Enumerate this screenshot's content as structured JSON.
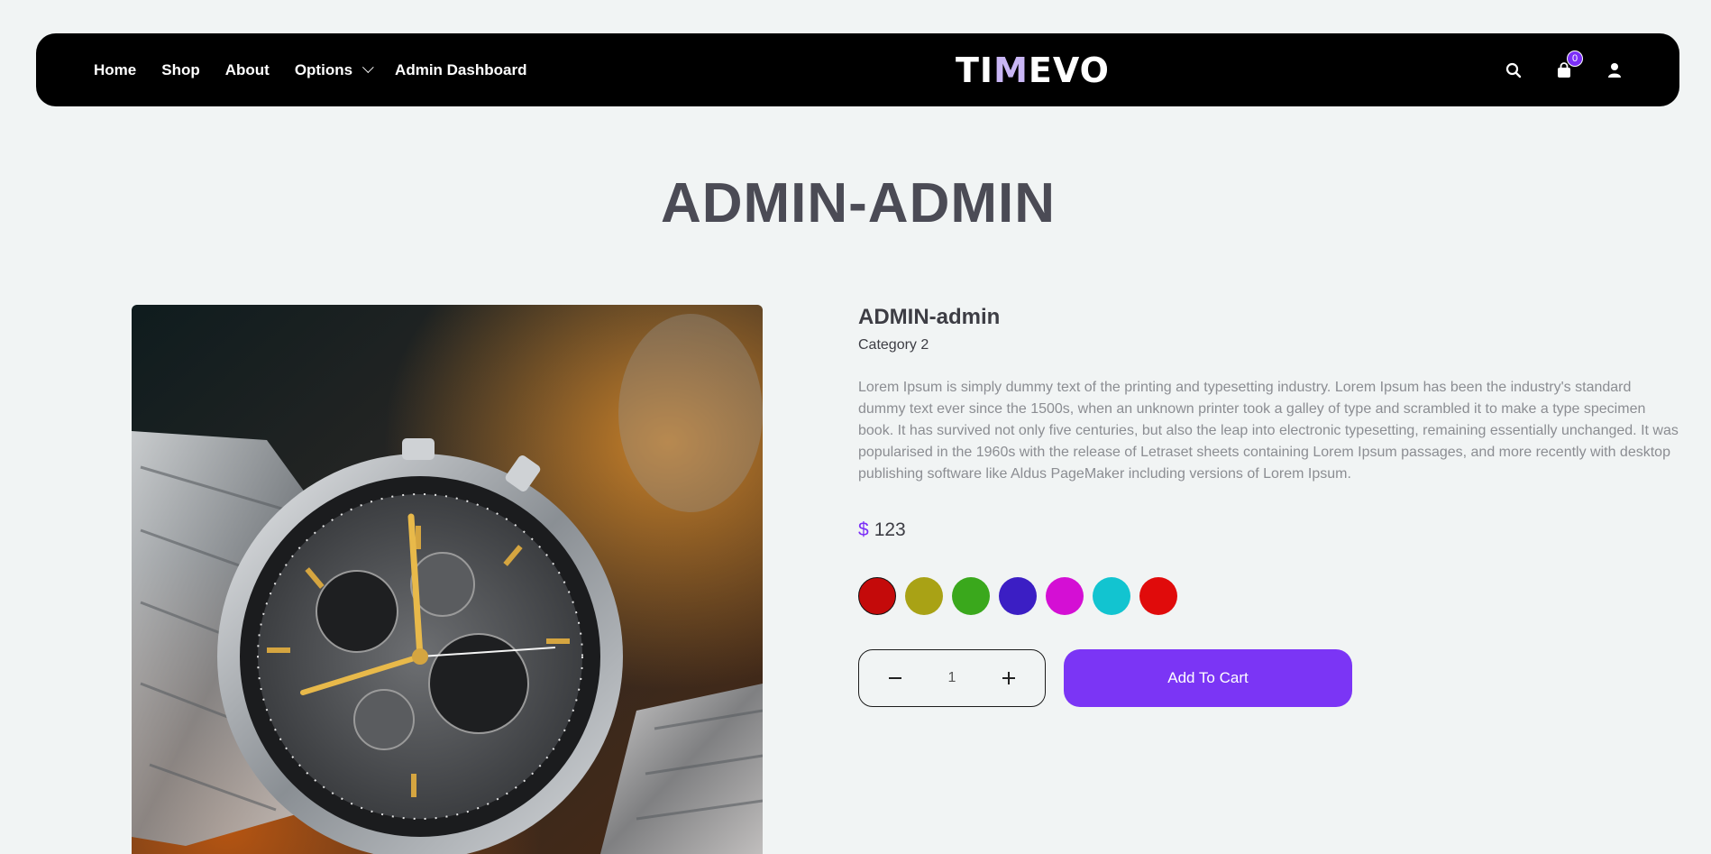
{
  "nav": {
    "links": [
      "Home",
      "Shop",
      "About",
      "Options",
      "Admin Dashboard"
    ],
    "logo_left": "TI",
    "logo_accent": "M",
    "logo_right": "EVO",
    "cart_count": "0"
  },
  "page": {
    "title": "ADMIN-ADMIN"
  },
  "product": {
    "name": "ADMIN-admin",
    "category": "Category 2",
    "description": "Lorem Ipsum is simply dummy text of the printing and typesetting industry. Lorem Ipsum has been the industry's standard dummy text ever since the 1500s, when an unknown printer took a galley of type and scrambled it to make a type specimen book. It has survived not only five centuries, but also the leap into electronic typesetting, remaining essentially unchanged. It was popularised in the 1960s with the release of Letraset sheets containing Lorem Ipsum passages, and more recently with desktop publishing software like Aldus PageMaker including versions of Lorem Ipsum.",
    "currency": "$",
    "price": "123",
    "colors": [
      "#c40a0a",
      "#a9a215",
      "#3aa81c",
      "#3b1ec4",
      "#d40fd4",
      "#12c4d0",
      "#e00b0b"
    ],
    "quantity": "1",
    "add_to_cart_label": "Add To Cart"
  },
  "icons": {
    "search": "search-icon",
    "cart": "shopping-bag-icon",
    "user": "user-icon",
    "options_caret": "chevron-down-icon"
  }
}
